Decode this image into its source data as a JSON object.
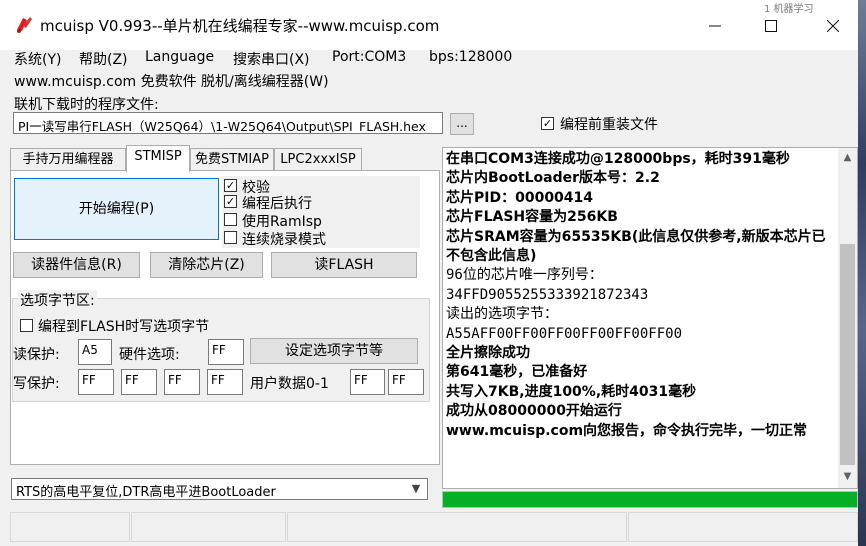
{
  "window": {
    "title": "mcuisp V0.993--单片机在线编程专家--www.mcuisp.com",
    "behind_text": "1  机器学习"
  },
  "menu": [
    {
      "label": "系统(Y)"
    },
    {
      "label": "帮助(Z)"
    },
    {
      "label": "Language"
    },
    {
      "label": "搜索串口(X)"
    },
    {
      "label": "Port:COM3"
    },
    {
      "label": "bps:128000"
    }
  ],
  "line2": "www.mcuisp.com 免费软件 脱机/离线编程器(W)",
  "file": {
    "label": "联机下载时的程序文件:",
    "path": "PI一读写串行FLASH（W25Q64）\\1-W25Q64\\Output\\SPI_FLASH.hex",
    "browse_label": "...",
    "reload_label": "编程前重装文件",
    "reload_checked": "✓"
  },
  "tabs": [
    {
      "label": "手持万用编程器"
    },
    {
      "label": "STMISP"
    },
    {
      "label": "免费STMIAP"
    },
    {
      "label": "LPC2xxxISP"
    }
  ],
  "stmisp": {
    "start_label": "开始编程(P)",
    "options": [
      {
        "label": "校验",
        "checked": "✓"
      },
      {
        "label": "编程后执行",
        "checked": "✓"
      },
      {
        "label": "使用RamIsp",
        "checked": ""
      },
      {
        "label": "连续烧录模式",
        "checked": ""
      }
    ],
    "read_info_label": "读器件信息(R)",
    "erase_label": "清除芯片(Z)",
    "read_flash_label": "读FLASH"
  },
  "option_bytes": {
    "group_label": "选项字节区:",
    "write_opt_label": "编程到FLASH时写选项字节",
    "read_protect_label": "读保护:",
    "read_protect_value": "A5",
    "hw_options_label": "硬件选项:",
    "hw_options_value": "FF",
    "set_button_label": "设定选项字节等",
    "write_protect_label": "写保护:",
    "write_protect_values": [
      "FF",
      "FF",
      "FF",
      "FF"
    ],
    "user_data_label": "用户数据0-1",
    "user_data_values": [
      "FF",
      "FF"
    ]
  },
  "boot_mode": {
    "selected": "RTS的高电平复位,DTR高电平进BootLoader"
  },
  "log": [
    {
      "text": "在串口COM3连接成功@128000bps，耗时391毫秒",
      "bold": true
    },
    {
      "text": "芯片内BootLoader版本号：2.2",
      "bold": true
    },
    {
      "text": "芯片PID：00000414",
      "bold": true
    },
    {
      "text": "芯片FLASH容量为256KB",
      "bold": true
    },
    {
      "text": "芯片SRAM容量为65535KB(此信息仅供参考,新版本芯片已不包含此信息)",
      "bold": true
    },
    {
      "text": "96位的芯片唯一序列号：",
      "bold": false
    },
    {
      "text": "34FFD9055255333921872343",
      "bold": false
    },
    {
      "text": "读出的选项字节：",
      "bold": false
    },
    {
      "text": "A55AFF00FF00FF00FF00FF00FF00",
      "bold": false
    },
    {
      "text": "全片擦除成功",
      "bold": true
    },
    {
      "text": "第641毫秒，已准备好",
      "bold": true
    },
    {
      "text": "共写入7KB,进度100%,耗时4031毫秒",
      "bold": true
    },
    {
      "text": "成功从08000000开始运行",
      "bold": true
    },
    {
      "text": "www.mcuisp.com向您报告，命令执行完毕，一切正常",
      "bold": true
    }
  ],
  "progress": {
    "value": 1.0,
    "color": "#06b025"
  },
  "colors": {
    "accent": "#0078d7",
    "app_icon": "#d32020"
  }
}
